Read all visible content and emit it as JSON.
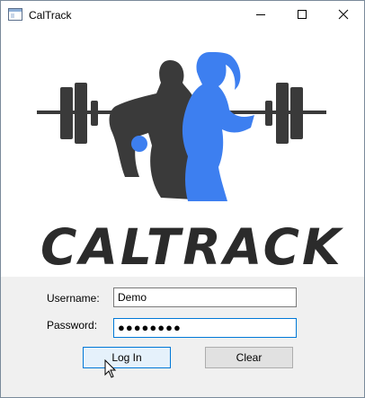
{
  "window": {
    "title": "CalTrack"
  },
  "titlebar_buttons": {
    "minimize": "minimize-icon",
    "maximize": "maximize-icon",
    "close": "close-icon"
  },
  "logo": {
    "text": "CALTRACK"
  },
  "form": {
    "username_label": "Username:",
    "username_value": "Demo",
    "password_label": "Password:",
    "password_mask": "●●●●●●●●",
    "login_label": "Log In",
    "clear_label": "Clear"
  },
  "colors": {
    "accent": "#0078d7",
    "female_figure": "#3d7ff0",
    "male_figure": "#3a3a3a",
    "form_bg": "#f0f0f0"
  }
}
